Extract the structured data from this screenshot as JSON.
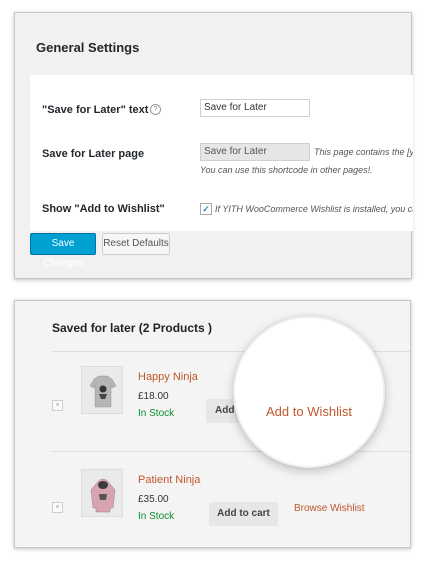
{
  "general_settings": {
    "title": "General Settings",
    "rows": {
      "save_text": {
        "label": "\"Save for Later\" text",
        "help": "?",
        "value": "Save for Later"
      },
      "page": {
        "label": "Save for Later page",
        "value": "Save for Later",
        "desc_line1": "This page contains the [yith_ws",
        "desc_line2": "You can use this shortcode in other pages!."
      },
      "wishlist": {
        "label": "Show \"Add to Wishlist\"",
        "checked_mark": "✓",
        "desc": "If YITH WooCommerce Wishlist is installed, you can dis"
      }
    },
    "buttons": {
      "save": "Save Changes",
      "reset": "Reset Defaults"
    }
  },
  "saved_for_later": {
    "title": "Saved for later (2 Products )",
    "remove_glyph": "×",
    "products": [
      {
        "name": "Happy Ninja",
        "price": "£18.00",
        "stock": "In Stock",
        "button": "Add"
      },
      {
        "name": "Patient Ninja",
        "price": "£35.00",
        "stock": "In Stock",
        "button": "Add to cart",
        "link": "Browse Wishlist"
      }
    ],
    "magnified_label": "Add to Wishlist"
  },
  "colors": {
    "primary_button": "#00a0d2",
    "product_link": "#c0572d",
    "in_stock": "#0a8c2a"
  }
}
